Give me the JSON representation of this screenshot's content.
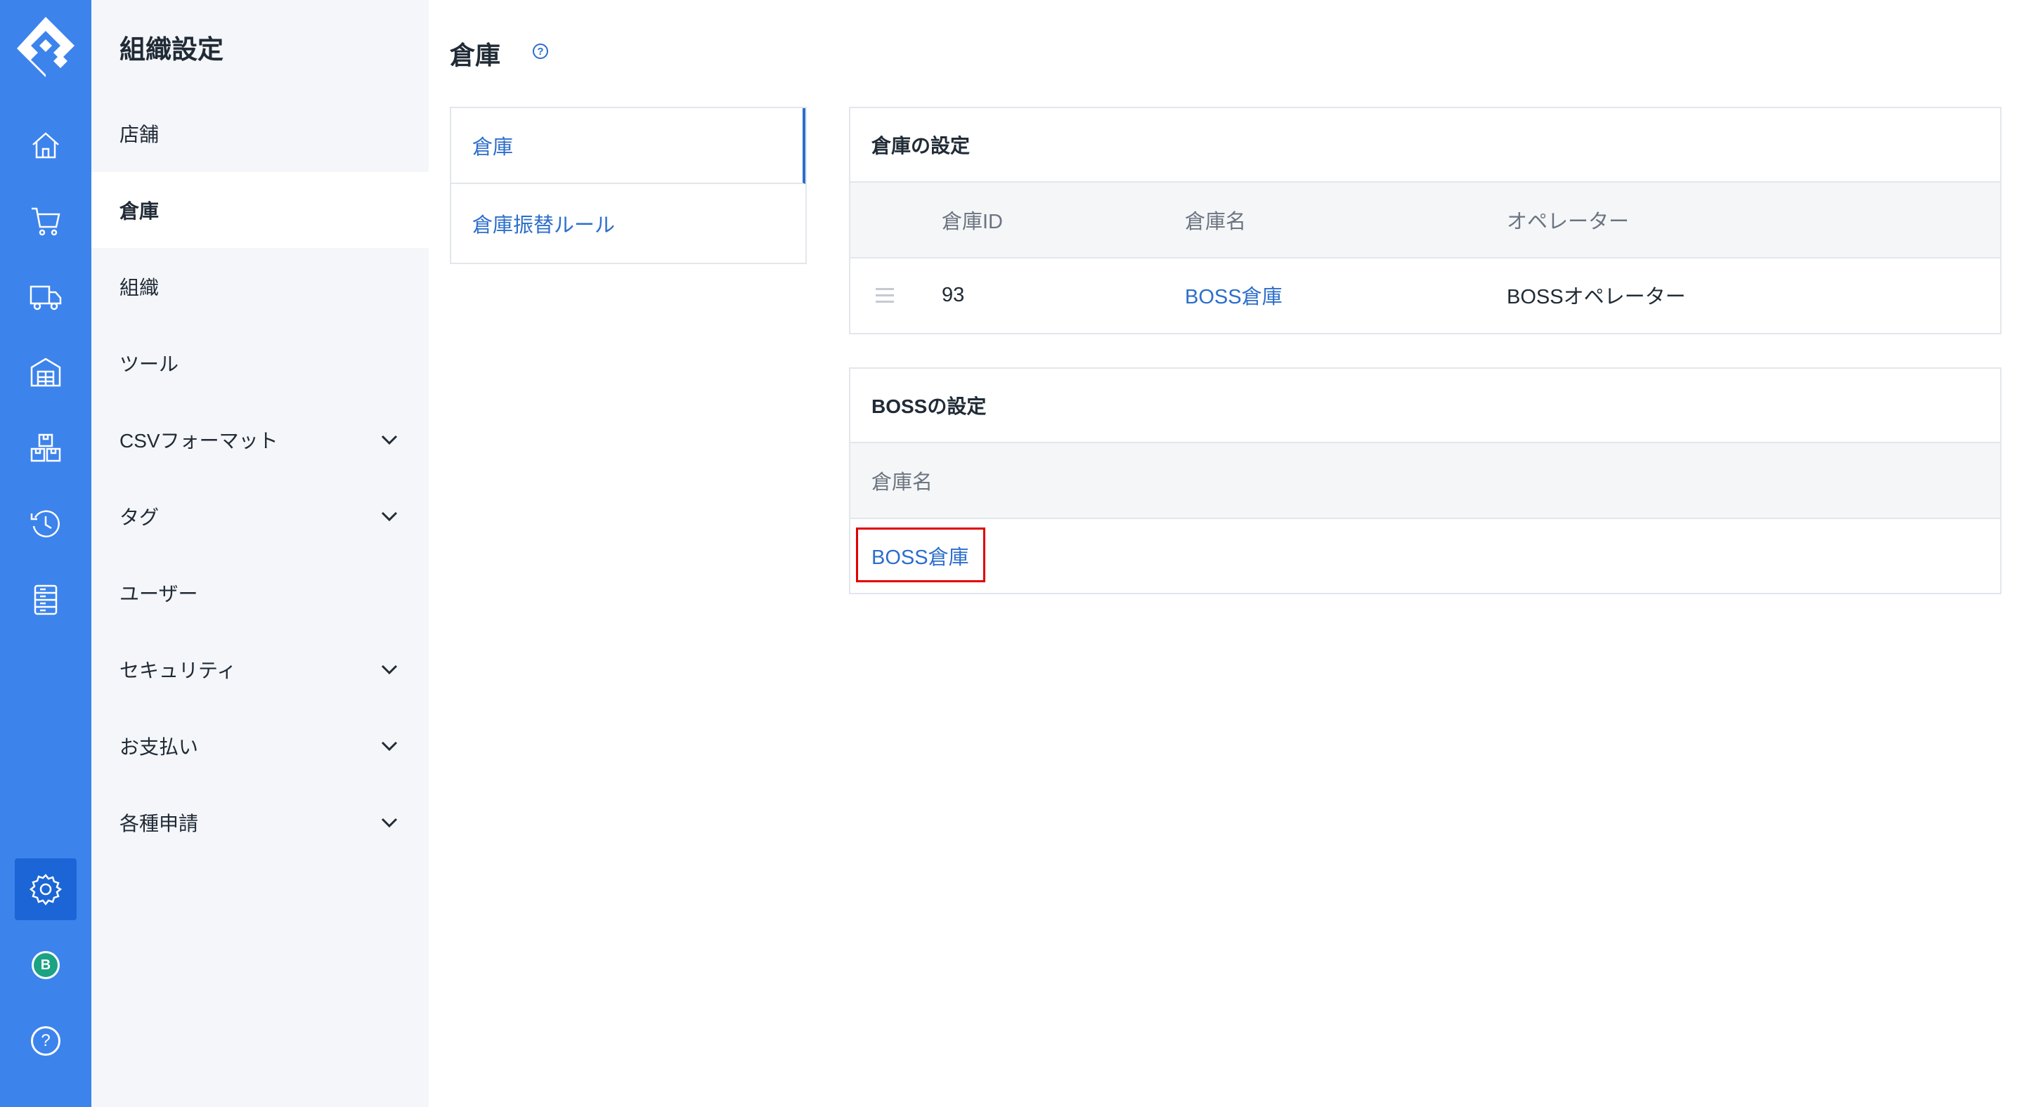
{
  "rail": {
    "icons": [
      "logo-icon",
      "home-icon",
      "cart-icon",
      "truck-icon",
      "warehouse-icon",
      "boxes-icon",
      "history-icon",
      "list-icon",
      "gear-icon",
      "avatar-icon",
      "help-icon"
    ],
    "avatar_letter": "B",
    "help_glyph": "?"
  },
  "sidebar": {
    "title": "組織設定",
    "items": [
      {
        "label": "店舗"
      },
      {
        "label": "倉庫"
      },
      {
        "label": "組織"
      },
      {
        "label": "ツール"
      },
      {
        "label": "CSVフォーマット"
      },
      {
        "label": "タグ"
      },
      {
        "label": "ユーザー"
      },
      {
        "label": "セキュリティ"
      },
      {
        "label": "お支払い"
      },
      {
        "label": "各種申請"
      }
    ]
  },
  "main": {
    "title": "倉庫",
    "help_glyph": "?",
    "subnav": [
      {
        "label": "倉庫"
      },
      {
        "label": "倉庫振替ルール"
      }
    ],
    "warehouse_settings": {
      "heading": "倉庫の設定",
      "columns": [
        "倉庫ID",
        "倉庫名",
        "オペレーター"
      ],
      "rows": [
        {
          "id": "93",
          "name": "BOSS倉庫",
          "operator": "BOSSオペレーター"
        }
      ]
    },
    "boss_settings": {
      "heading": "BOSSの設定",
      "columns": [
        "倉庫名"
      ],
      "rows": [
        {
          "name": "BOSS倉庫"
        }
      ]
    }
  },
  "colors": {
    "rail": "#3c83ec",
    "rail_active": "#1b65d6",
    "link": "#2c6ecb",
    "highlight": "#e00000"
  }
}
